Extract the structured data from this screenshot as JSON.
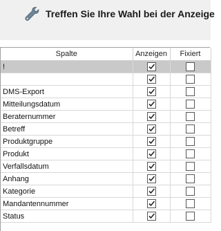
{
  "header": {
    "icon": "wrench-icon",
    "title": "Treffen Sie Ihre Wahl bei der Anzeige"
  },
  "table": {
    "columns": [
      "Spalte",
      "Anzeigen",
      "Fixiert"
    ],
    "rows": [
      {
        "name": "!",
        "anzeigen": true,
        "fixiert": false,
        "selected": true
      },
      {
        "name": "",
        "anzeigen": true,
        "fixiert": false,
        "selected": false
      },
      {
        "name": "DMS-Export",
        "anzeigen": true,
        "fixiert": false,
        "selected": false
      },
      {
        "name": "Mitteilungsdatum",
        "anzeigen": true,
        "fixiert": false,
        "selected": false
      },
      {
        "name": "Beraternummer",
        "anzeigen": true,
        "fixiert": false,
        "selected": false
      },
      {
        "name": "Betreff",
        "anzeigen": true,
        "fixiert": false,
        "selected": false
      },
      {
        "name": "Produktgruppe",
        "anzeigen": true,
        "fixiert": false,
        "selected": false
      },
      {
        "name": "Produkt",
        "anzeigen": true,
        "fixiert": false,
        "selected": false
      },
      {
        "name": "Verfallsdatum",
        "anzeigen": true,
        "fixiert": false,
        "selected": false
      },
      {
        "name": "Anhang",
        "anzeigen": true,
        "fixiert": false,
        "selected": false
      },
      {
        "name": "Kategorie",
        "anzeigen": true,
        "fixiert": false,
        "selected": false
      },
      {
        "name": "Mandantennummer",
        "anzeigen": true,
        "fixiert": false,
        "selected": false
      },
      {
        "name": "Status",
        "anzeigen": true,
        "fixiert": false,
        "selected": false
      }
    ]
  },
  "colors": {
    "header_bg": "#f0f0f0",
    "selected_row": "#c9c9c9",
    "icon": "#6f8596"
  }
}
